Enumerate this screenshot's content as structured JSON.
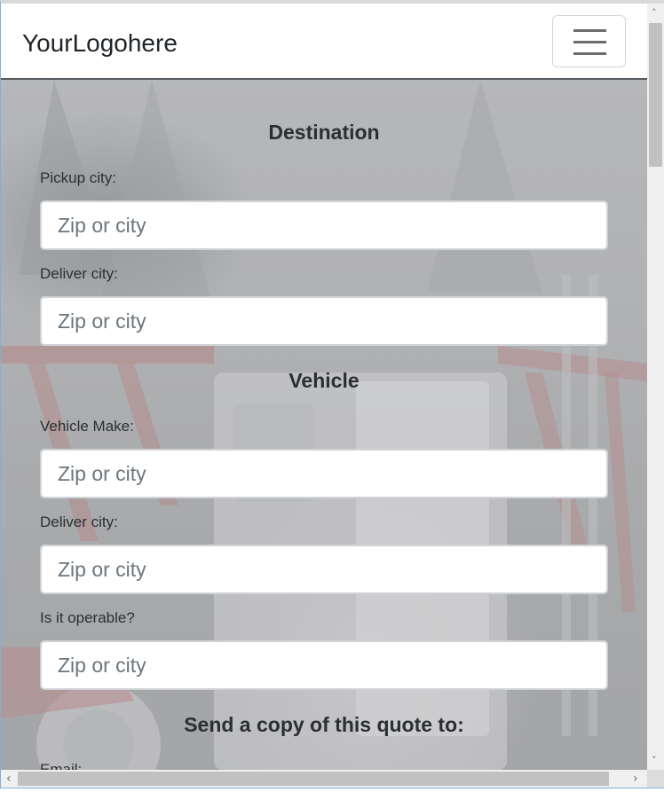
{
  "navbar": {
    "brand": "YourLogohere",
    "toggle_icon": "hamburger-menu-icon"
  },
  "sections": {
    "destination_title": "Destination",
    "vehicle_title": "Vehicle",
    "send_copy_title": "Send a copy of this quote to:"
  },
  "fields": {
    "pickup_city": {
      "label": "Pickup city:",
      "placeholder": "Zip or city",
      "value": ""
    },
    "deliver_city": {
      "label": "Deliver city:",
      "placeholder": "Zip or city",
      "value": ""
    },
    "vehicle_make": {
      "label": "Vehicle Make:",
      "placeholder": "Zip or city",
      "value": ""
    },
    "vehicle_deliver_city": {
      "label": "Deliver city:",
      "placeholder": "Zip or city",
      "value": ""
    },
    "operable": {
      "label": "Is it operable?",
      "placeholder": "Zip or city",
      "value": ""
    },
    "email": {
      "label": "Email:"
    }
  },
  "scrollbars": {
    "up_arrow": "˄",
    "down_arrow": "˅",
    "left_arrow": "‹",
    "right_arrow": "›"
  }
}
